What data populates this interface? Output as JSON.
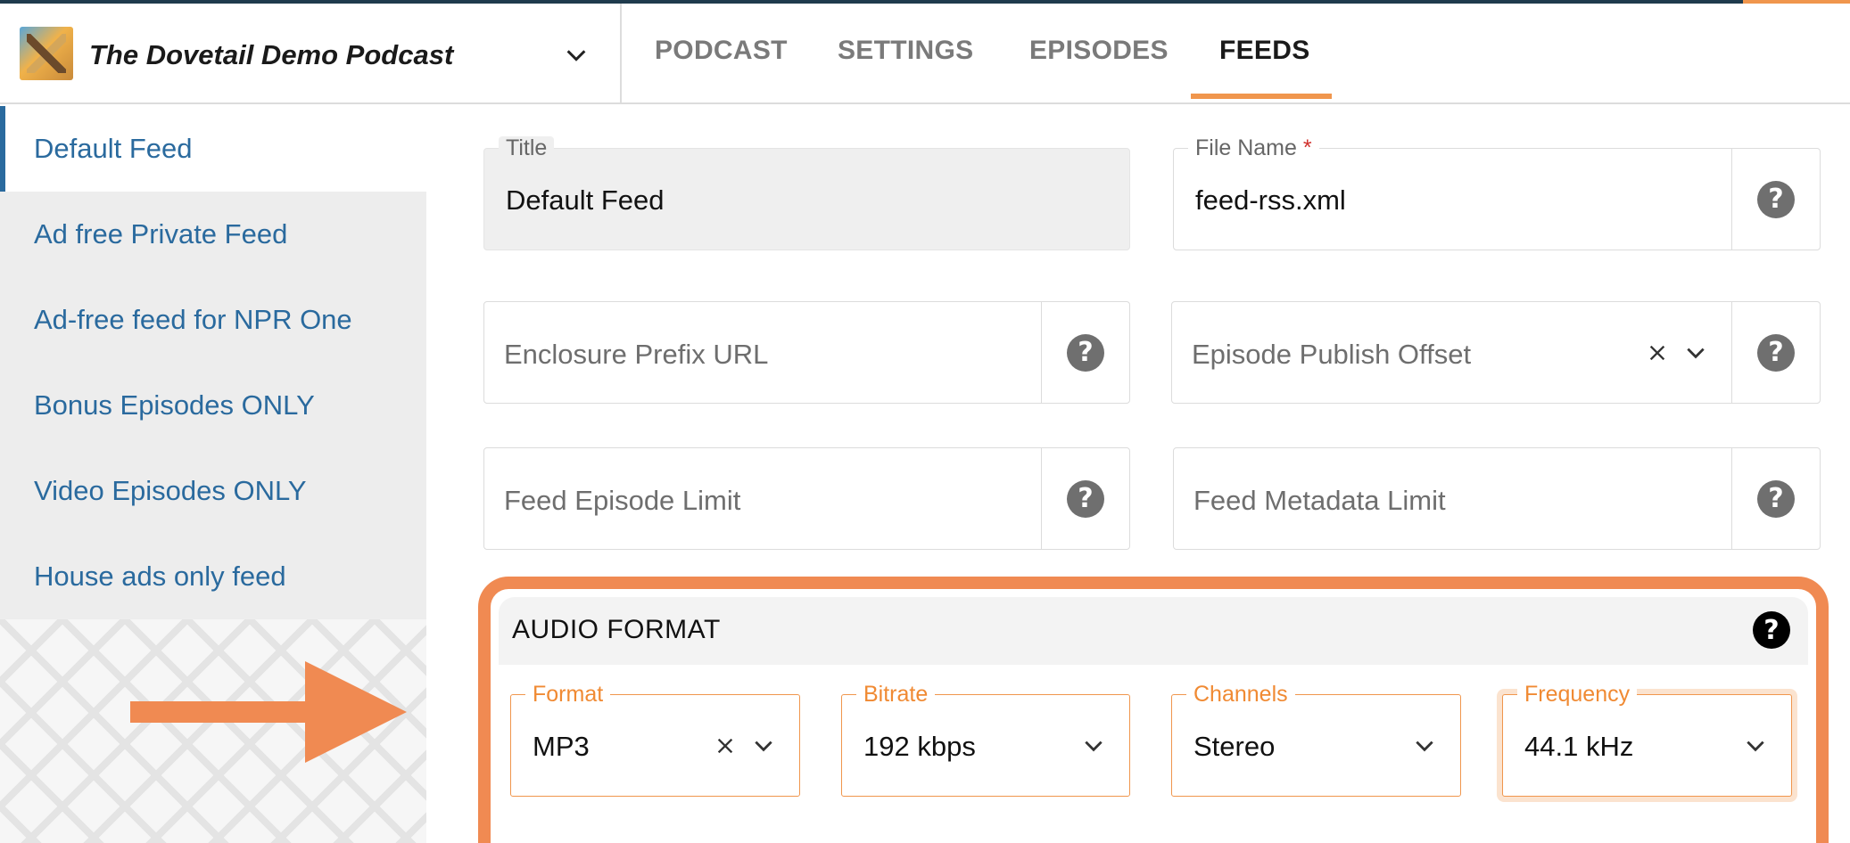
{
  "app": {
    "title": "The Dovetail Demo Podcast"
  },
  "nav": {
    "tabs": [
      {
        "label": "PODCAST"
      },
      {
        "label": "SETTINGS"
      },
      {
        "label": "EPISODES"
      },
      {
        "label": "FEEDS",
        "active": true
      }
    ]
  },
  "sidebar": {
    "items": [
      {
        "label": "Default Feed",
        "active": true
      },
      {
        "label": "Ad free Private Feed"
      },
      {
        "label": "Ad-free feed for NPR One"
      },
      {
        "label": "Bonus Episodes ONLY"
      },
      {
        "label": "Video Episodes ONLY"
      },
      {
        "label": "House ads only feed"
      }
    ]
  },
  "form": {
    "title": {
      "label": "Title",
      "value": "Default Feed"
    },
    "file_name": {
      "label": "File Name",
      "required_mark": "*",
      "value": "feed-rss.xml"
    },
    "enclosure_prefix": {
      "placeholder": "Enclosure Prefix URL"
    },
    "publish_offset": {
      "placeholder": "Episode Publish Offset"
    },
    "episode_limit": {
      "placeholder": "Feed Episode Limit"
    },
    "metadata_limit": {
      "placeholder": "Feed Metadata Limit"
    }
  },
  "audio_format": {
    "heading": "AUDIO FORMAT",
    "format": {
      "label": "Format",
      "value": "MP3"
    },
    "bitrate": {
      "label": "Bitrate",
      "value": "192 kbps"
    },
    "channels": {
      "label": "Channels",
      "value": "Stereo"
    },
    "frequency": {
      "label": "Frequency",
      "value": "44.1 kHz"
    }
  },
  "icons": {
    "help": "?",
    "clear": "×"
  },
  "colors": {
    "accent": "#f08a52",
    "link": "#2a6a9e",
    "header_bar": "#1f3b4d"
  }
}
